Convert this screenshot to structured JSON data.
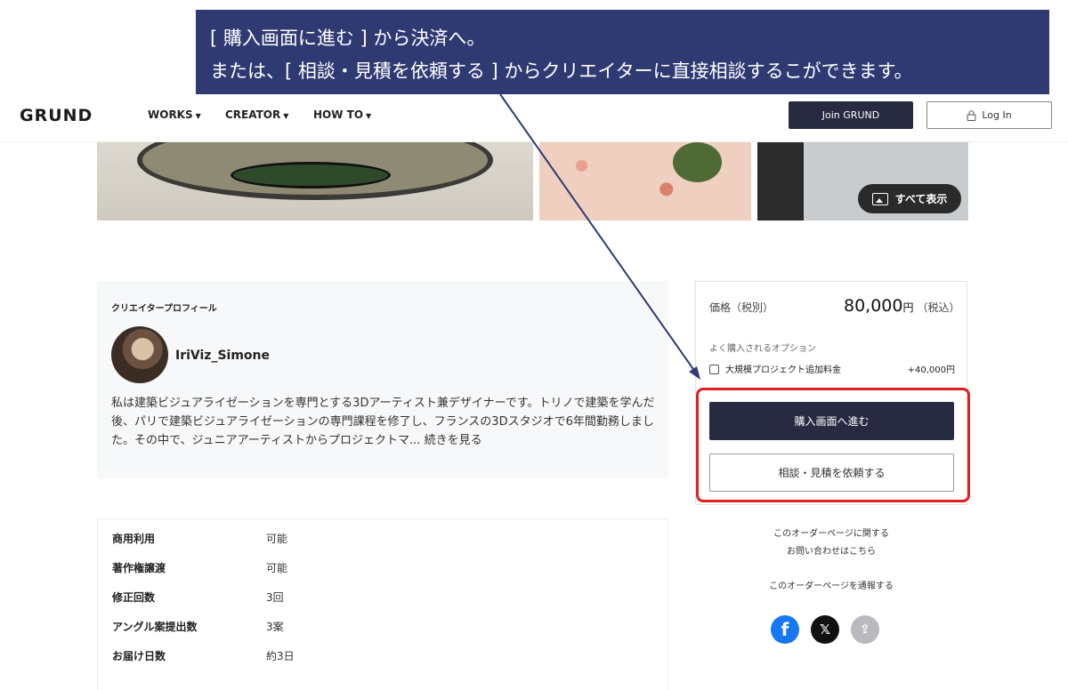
{
  "callout": {
    "line1": "[ 購入画面に進む ] から決済へ。",
    "line2": "または、[ 相談・見積を依頼する ] からクリエイターに直接相談するこができます。"
  },
  "header": {
    "logo": "GRUND",
    "nav": [
      {
        "label": "WORKS"
      },
      {
        "label": "CREATOR"
      },
      {
        "label": "HOW TO"
      }
    ],
    "join_label": "Join GRUND",
    "login_label": "Log In"
  },
  "gallery": {
    "show_all_label": "すべて表示"
  },
  "profile": {
    "heading": "クリエイタープロフィール",
    "username": "IriViz_Simone",
    "bio": "私は建築ビジュアライゼーションを専門とする3Dアーティスト兼デザイナーです。トリノで建築を学んだ後、パリで建築ビジュアライゼーションの専門課程を修了し、フランスの3Dスタジオで6年間勤務しました。その中で、ジュニアアーティストからプロジェクトマ...",
    "more_label": "続きを見る"
  },
  "specs": [
    {
      "label": "商用利用",
      "value": "可能"
    },
    {
      "label": "著作権譲渡",
      "value": "可能"
    },
    {
      "label": "修正回数",
      "value": "3回"
    },
    {
      "label": "アングル案提出数",
      "value": "3案"
    },
    {
      "label": "お届け日数",
      "value": "約3日"
    }
  ],
  "price": {
    "label": "価格（税別）",
    "amount": "80,000",
    "unit": "円",
    "tax_note": "（税込）",
    "options_heading": "よく購入されるオプション",
    "option_label": "大規模プロジェクト追加料金",
    "option_price": "+40,000円",
    "purchase_label": "購入画面へ進む",
    "consult_label": "相談・見積を依頼する"
  },
  "side": {
    "inquiry_line1": "このオーダーページに関する",
    "inquiry_line2": "お問い合わせはこちら",
    "report": "このオーダーページを通報する"
  },
  "social": {
    "facebook_glyph": "f",
    "x_glyph": "𝕏",
    "share_glyph": "⇪"
  },
  "colors": {
    "callout": "#2f3a72",
    "primary_button": "#272a40",
    "highlight": "#e02020",
    "facebook": "#1877f2"
  }
}
